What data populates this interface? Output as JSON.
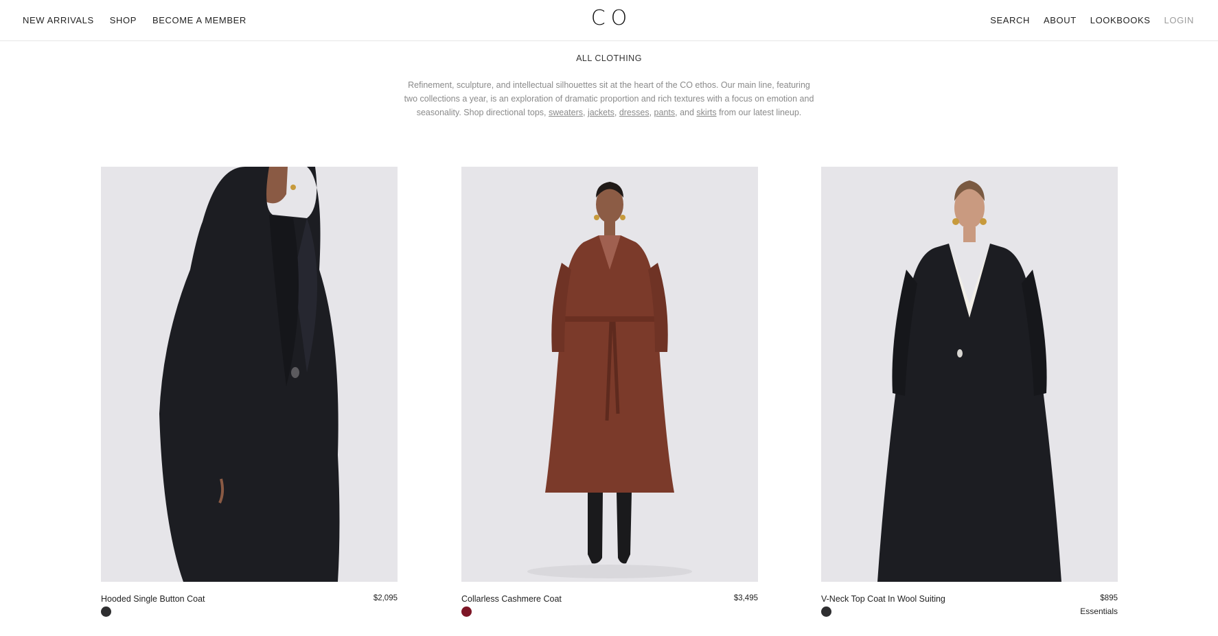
{
  "header": {
    "logo": "CO",
    "nav_left": [
      "NEW ARRIVALS",
      "SHOP",
      "BECOME A MEMBER"
    ],
    "nav_right": [
      "SEARCH",
      "ABOUT",
      "LOOKBOOKS",
      "LOGIN"
    ]
  },
  "intro": {
    "title": "ALL CLOTHING",
    "text_before": "Refinement, sculpture, and intellectual silhouettes sit at the heart of the CO ethos. Our main line, featuring two collections a year, is an exploration of dramatic proportion and rich textures with a focus on emotion and seasonality. Shop directional tops, ",
    "links": [
      "sweaters",
      "jackets",
      "dresses",
      "pants",
      "skirts"
    ],
    "sep_comma": ", ",
    "sep_and": ", and ",
    "text_after": " from our latest lineup."
  },
  "products": [
    {
      "name": "Hooded Single Button Coat",
      "price": "$2,095",
      "swatch_color": "#2e2e30",
      "tag": ""
    },
    {
      "name": "Collarless Cashmere Coat",
      "price": "$3,495",
      "swatch_color": "#7d1626",
      "tag": ""
    },
    {
      "name": "V-Neck Top Coat In Wool Suiting",
      "price": "$895",
      "swatch_color": "#2e2e30",
      "tag": "Essentials"
    }
  ],
  "colors": {
    "photo_bg": "#e6e5e9",
    "coat_black": "#1c1d22",
    "coat_rust": "#7b3a2a",
    "muted_text": "#8a8a8a"
  }
}
